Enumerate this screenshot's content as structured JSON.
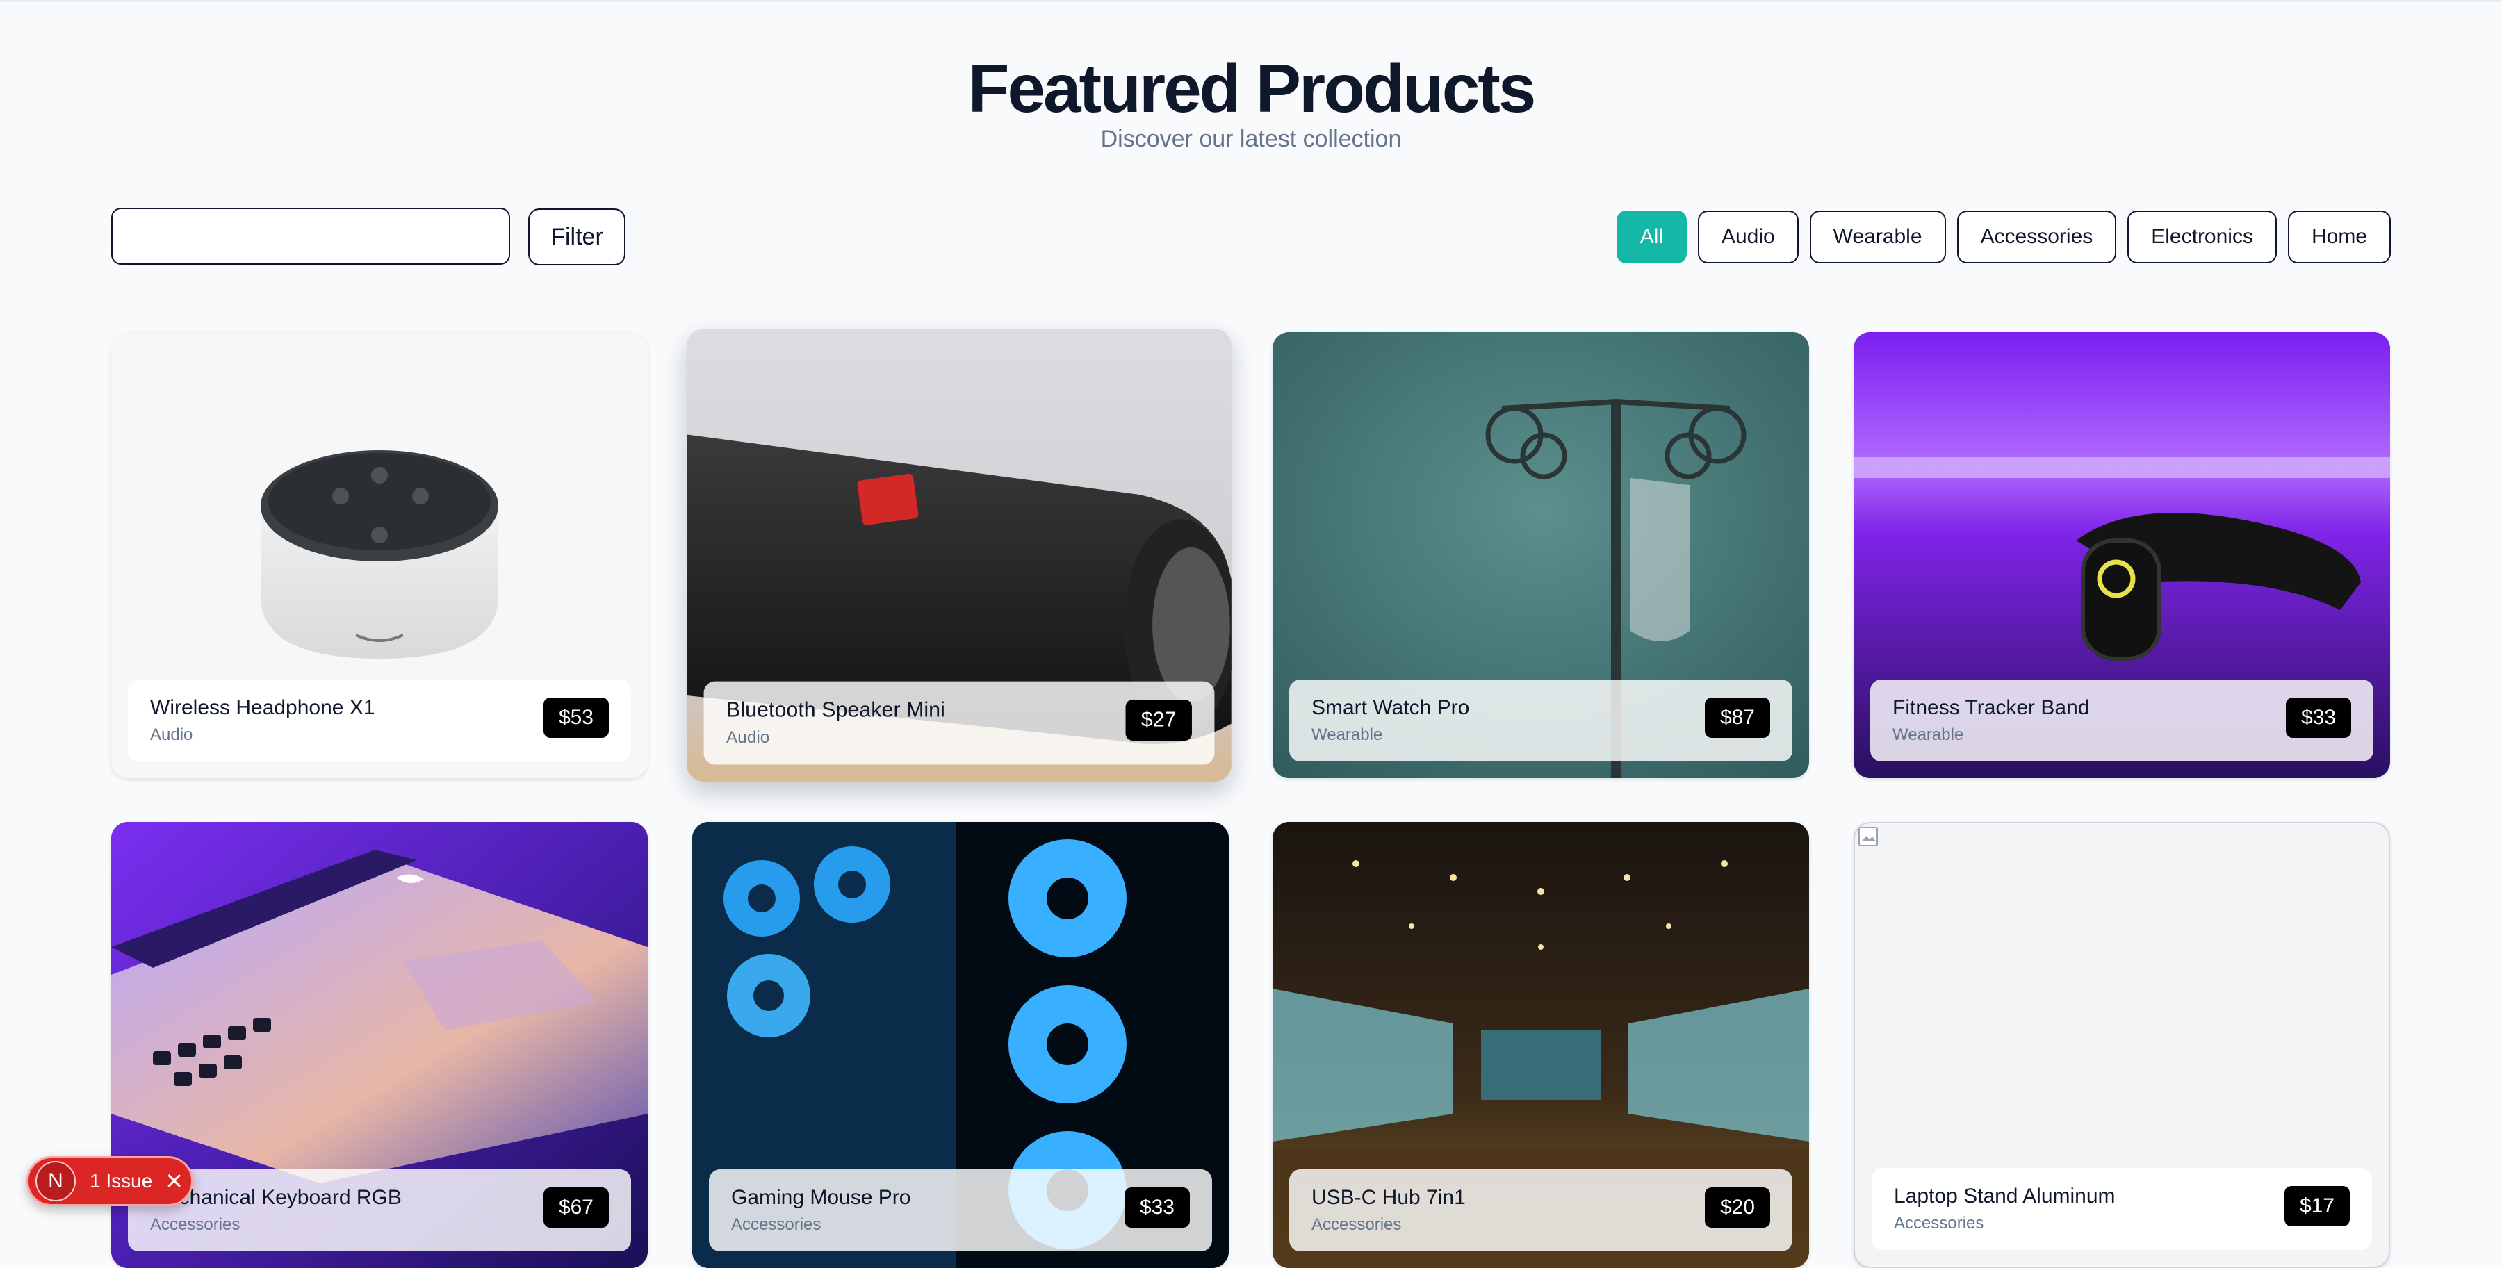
{
  "header": {
    "title": "Featured Products",
    "subtitle": "Discover our latest collection"
  },
  "search": {
    "value": "",
    "placeholder": "",
    "filter_label": "Filter"
  },
  "categories": {
    "active": "All",
    "items": [
      "All",
      "Audio",
      "Wearable",
      "Accessories",
      "Electronics",
      "Home"
    ]
  },
  "products": [
    {
      "name": "Wireless Headphone X1",
      "category": "Audio",
      "price": "$53",
      "image": "smart-speaker-photo"
    },
    {
      "name": "Bluetooth Speaker Mini",
      "category": "Audio",
      "price": "$27",
      "image": "portable-speaker-photo"
    },
    {
      "name": "Smart Watch Pro",
      "category": "Wearable",
      "price": "$87",
      "image": "iv-stand-photo"
    },
    {
      "name": "Fitness Tracker Band",
      "category": "Wearable",
      "price": "$33",
      "image": "fitness-band-photo"
    },
    {
      "name": "Mechanical Keyboard RGB",
      "category": "Accessories",
      "price": "$67",
      "image": "laptop-photo"
    },
    {
      "name": "Gaming Mouse Pro",
      "category": "Accessories",
      "price": "$33",
      "image": "pc-fans-photo"
    },
    {
      "name": "USB-C Hub 7in1",
      "category": "Accessories",
      "price": "$20",
      "image": "conference-hall-photo"
    },
    {
      "name": "Laptop Stand Aluminum",
      "category": "Accessories",
      "price": "$17",
      "image": "broken-image-icon"
    }
  ],
  "dev_overlay": {
    "logo": "N",
    "label": "1 Issue",
    "close_icon": "close-icon"
  },
  "colors": {
    "accent": "#14b8a6",
    "text": "#0f172a",
    "muted": "#64748b",
    "error": "#dc2626"
  }
}
